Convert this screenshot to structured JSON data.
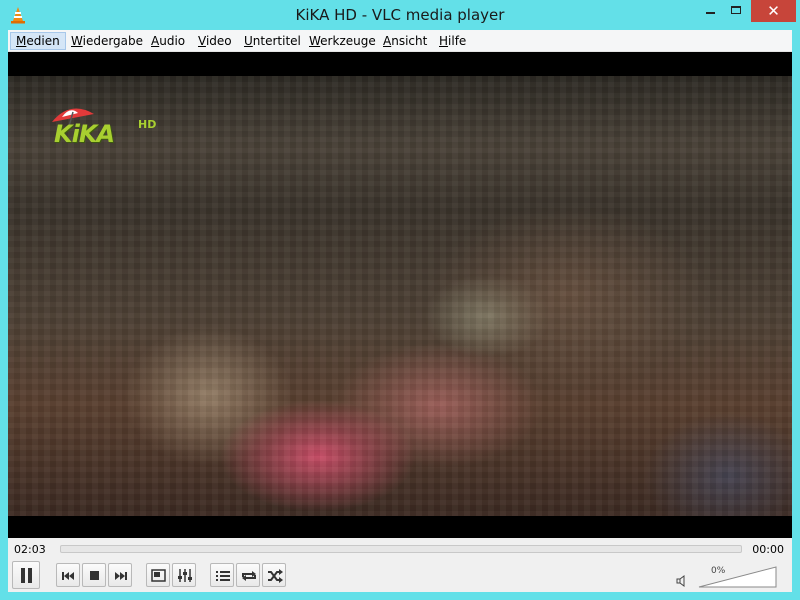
{
  "window": {
    "title": "KiKA HD - VLC media player",
    "close_glyph": "✕",
    "accent_color": "#63e0e8"
  },
  "menu": {
    "items": [
      {
        "label": "Medien",
        "accel": "M",
        "active": true
      },
      {
        "label": "Wiedergabe",
        "accel": "W"
      },
      {
        "label": "Audio",
        "accel": "A"
      },
      {
        "label": "Video",
        "accel": "V"
      },
      {
        "label": "Untertitel",
        "accel": "U"
      },
      {
        "label": "Werkzeuge",
        "accel": "W"
      },
      {
        "label": "Ansicht",
        "accel": "A"
      },
      {
        "label": "Hilfe",
        "accel": "H"
      }
    ]
  },
  "video": {
    "channel_logo": "KiKA",
    "channel_logo_suffix": "HD"
  },
  "playback": {
    "elapsed": "02:03",
    "total": "00:00",
    "progress": 0.0
  },
  "controls": {
    "icons": [
      "pause-icon",
      "previous-icon",
      "stop-icon",
      "next-icon",
      "fullscreen-icon",
      "extended-settings-icon",
      "playlist-icon",
      "loop-icon",
      "shuffle-icon"
    ]
  },
  "volume": {
    "label": "0%",
    "level": 0
  }
}
